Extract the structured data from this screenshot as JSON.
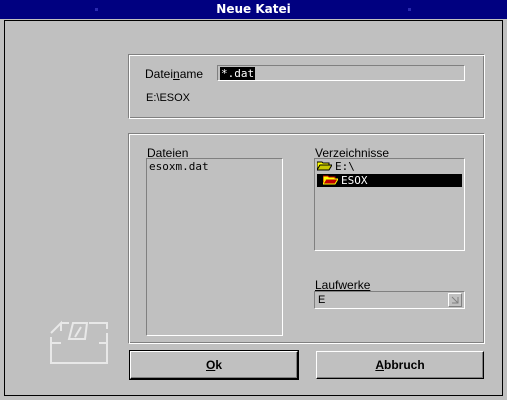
{
  "window": {
    "title": "Neue Katei"
  },
  "filename": {
    "label_prefix": "Datei",
    "label_mnemonic": "n",
    "label_suffix": "ame",
    "value": "*.dat"
  },
  "current_path": "E:\\ESOX",
  "files": {
    "label": "Dateien",
    "items": [
      "esoxm.dat"
    ]
  },
  "directories": {
    "label": "Verzeichnisse",
    "items": [
      "E:\\",
      "ESOX"
    ],
    "selected_index": 1
  },
  "drives": {
    "label": "Laufwerke",
    "selected": "E"
  },
  "buttons": {
    "ok_mnemonic": "O",
    "ok_rest": "k",
    "cancel_mnemonic": "A",
    "cancel_rest": "bbruch"
  },
  "colors": {
    "titlebar": "#000080",
    "face": "#c0c0c0",
    "selection": "#000000",
    "folder_yellow": "#ffff00",
    "folder_red": "#c00000"
  }
}
